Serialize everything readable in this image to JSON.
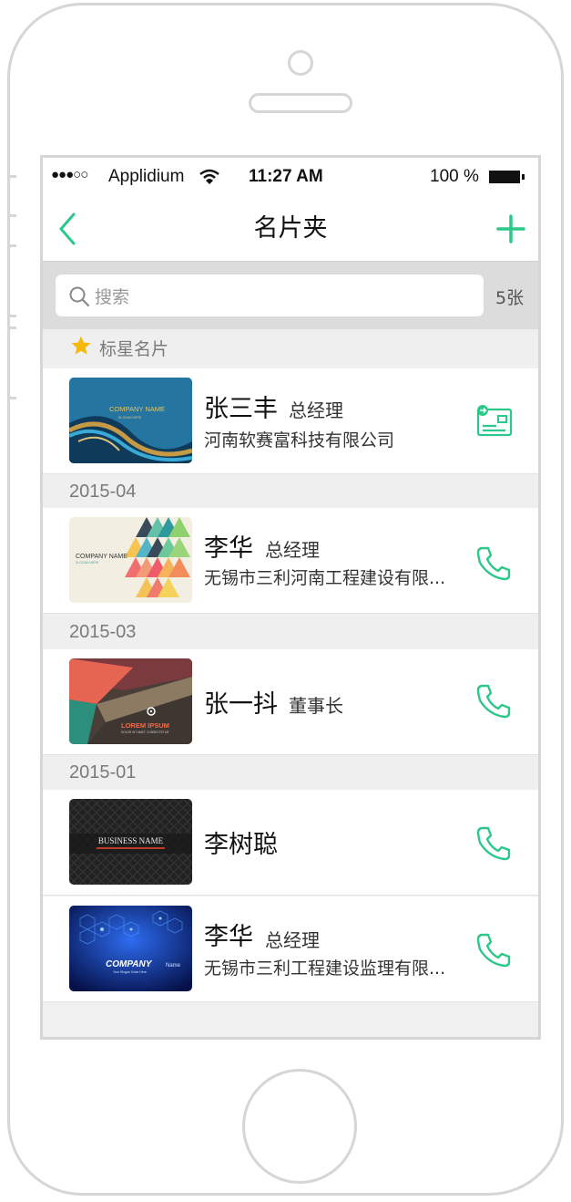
{
  "status_bar": {
    "signal": "●●●○○",
    "carrier": "Applidium",
    "time": "11:27 AM",
    "battery": "100 %"
  },
  "nav": {
    "title": "名片夹",
    "accent_color": "#2cc88a"
  },
  "search": {
    "placeholder": "搜索",
    "count": "5张"
  },
  "sections": [
    {
      "header": "标星名片",
      "cards": [
        {
          "name": "张三丰",
          "title": "总经理",
          "company": "河南软赛富科技有限公司",
          "thumb_text": "COMPANY NAME",
          "thumb_sub": "SLOGAN HERE",
          "action_icon": "business-card-icon"
        }
      ]
    },
    {
      "header": "2015-04",
      "cards": [
        {
          "name": "李华",
          "title": "总经理",
          "company": "无锡市三利河南工程建设有限...",
          "thumb_text": "COMPANY NAME",
          "thumb_sub": "SLOGAN HERE",
          "action_icon": "phone-icon"
        }
      ]
    },
    {
      "header": "2015-03",
      "cards": [
        {
          "name": "张一抖",
          "title": "董事长",
          "company": "",
          "thumb_text": "LOREM IPSUM",
          "thumb_sub": "DOLOR SIT AMET, CONSECTETUR",
          "action_icon": "phone-icon"
        }
      ]
    },
    {
      "header": "2015-01",
      "cards": [
        {
          "name": "李树聪",
          "title": "",
          "company": "",
          "thumb_text": "BUSINESS NAME",
          "thumb_sub": "",
          "action_icon": "phone-icon"
        },
        {
          "name": "李华",
          "title": "总经理",
          "company": "无锡市三利工程建设监理有限...",
          "thumb_text": "COMPANY",
          "thumb_text_2": "Name",
          "thumb_sub": "Your Slogan Goes Here",
          "action_icon": "phone-icon"
        }
      ]
    }
  ]
}
